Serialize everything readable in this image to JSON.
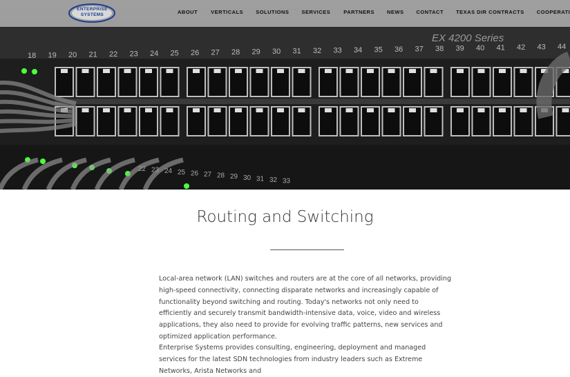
{
  "logo": {
    "line1": "ENTERPRISE",
    "line2": "SYSTEMS"
  },
  "nav": {
    "items": [
      {
        "label": "ABOUT"
      },
      {
        "label": "VERTICALS"
      },
      {
        "label": "SOLUTIONS"
      },
      {
        "label": "SERVICES"
      },
      {
        "label": "PARTNERS"
      },
      {
        "label": "NEWS"
      },
      {
        "label": "CONTACT"
      },
      {
        "label": "TEXAS DIR CONTRACTS"
      },
      {
        "label": "COOPERATIVES"
      }
    ]
  },
  "hero": {
    "model_label": "EX 4200 Series",
    "port_numbers_top": [
      "18",
      "19",
      "20",
      "21",
      "22",
      "23",
      "24",
      "25",
      "26",
      "27",
      "28",
      "29",
      "30",
      "31",
      "32",
      "33",
      "34",
      "35",
      "36",
      "37",
      "38",
      "39",
      "40",
      "41",
      "42",
      "43",
      "44"
    ],
    "port_numbers_bottom": [
      "22",
      "23",
      "24",
      "25",
      "26",
      "27",
      "28",
      "29",
      "30",
      "31",
      "32",
      "33"
    ]
  },
  "main": {
    "title": "Routing and Switching",
    "para1": "Local-area network (LAN) switches and routers are at the core of all networks, providing high-speed connectivity, connecting disparate networks and increasingly capable of functionality beyond switching and routing.  Today's networks not only need to efficiently and securely transmit bandwidth-intensive data, voice, video and wireless applications, they also need to provide for evolving traffic patterns, new services and optimized application performance.",
    "para2": "Enterprise Systems provides consulting, engineering, deployment and managed services for the latest SDN technologies from industry leaders such as Extreme Networks, Arista Networks and"
  },
  "colors": {
    "brand": "#1c3d8f",
    "led": "#4cff3a",
    "text": "#444444"
  }
}
